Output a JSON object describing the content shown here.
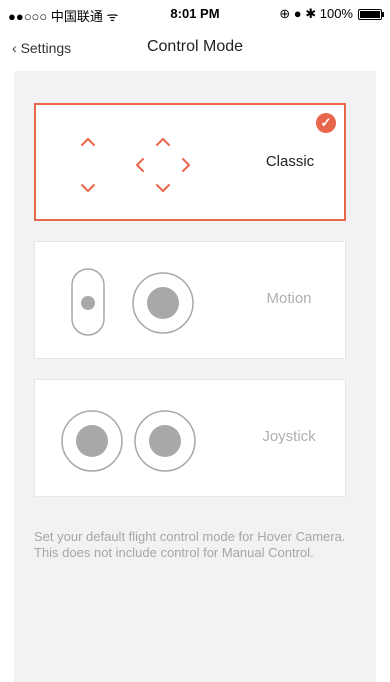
{
  "status_bar": {
    "carrier": "●●○○○ 中国联通 ᯤ",
    "time": "8:01 PM",
    "indicators": "⊕ ● ✱ 100%"
  },
  "nav": {
    "back_label": "Settings",
    "back_icon": "‹",
    "title": "Control Mode"
  },
  "modes": [
    {
      "label": "Classic",
      "selected": true
    },
    {
      "label": "Motion",
      "selected": false
    },
    {
      "label": "Joystick",
      "selected": false
    }
  ],
  "check_icon": "✓",
  "description": "Set your default flight control mode for Hover Camera. This does not include control for Manual Control.",
  "colors": {
    "accent": "#e8664b",
    "inactive": "#b0b0b0"
  }
}
